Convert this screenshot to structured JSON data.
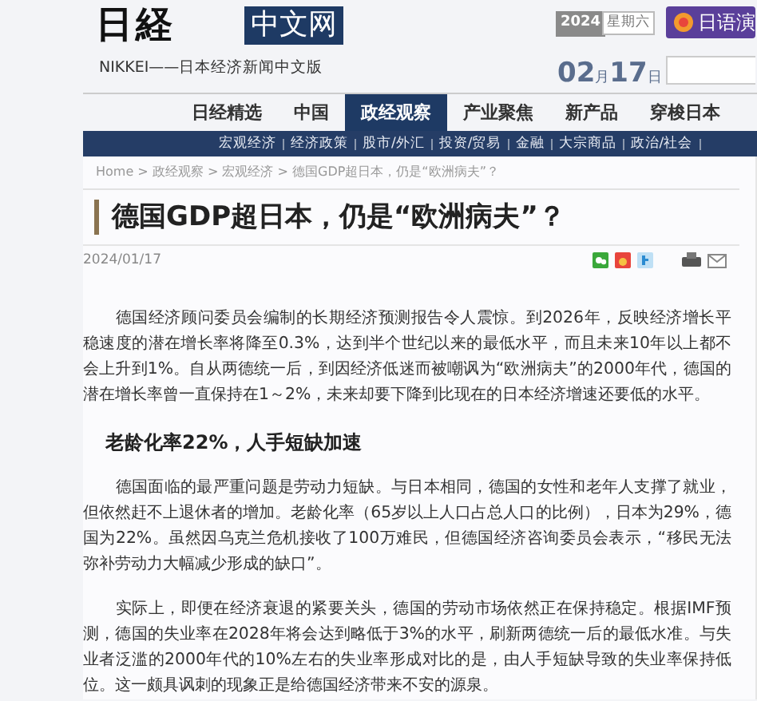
{
  "header": {
    "logo_mark": "日経",
    "logo_box": "中文网",
    "tagline": "NIKKEI——日本经济新闻中文版",
    "year": "2024",
    "weekday": "星期六",
    "month": "02",
    "month_unit": "月",
    "day": "17",
    "day_unit": "日",
    "promo_button": "日语演"
  },
  "nav": [
    {
      "label": "日经精选",
      "selected": false
    },
    {
      "label": "中国",
      "selected": false
    },
    {
      "label": "政经观察",
      "selected": true
    },
    {
      "label": "产业聚焦",
      "selected": false
    },
    {
      "label": "新产品",
      "selected": false
    },
    {
      "label": "穿梭日本",
      "selected": false
    }
  ],
  "subnav": [
    "宏观经济",
    "经济政策",
    "股市/外汇",
    "投资/贸易",
    "金融",
    "大宗商品",
    "政治/社会"
  ],
  "breadcrumb": "Home > 政经观察 > 宏观经济 > 德国GDP超日本，仍是“欧洲病夫”？",
  "article": {
    "title": "德国GDP超日本，仍是“欧洲病夫”？",
    "date": "2024/01/17",
    "blocks": [
      {
        "kind": "paragraph",
        "text": "德国经济顾问委员会编制的长期经济预测报告令人震惊。到2026年，反映经济增长平稳速度的潜在增长率将降至0.3%，达到半个世纪以来的最低水平，而且未来10年以上都不会上升到1%。自从两德统一后，到因经济低迷而被嘲讽为“欧洲病夫”的2000年代，德国的潜在增长率曾一直保持在1～2%，未来却要下降到比现在的日本经济增速还要低的水平。"
      },
      {
        "kind": "heading",
        "text": "老龄化率22%，人手短缺加速"
      },
      {
        "kind": "paragraph",
        "text": "德国面临的最严重问题是劳动力短缺。与日本相同，德国的女性和老年人支撑了就业，但依然赶不上退休者的增加。老龄化率（65岁以上人口占总人口的比例），日本为29%，德国为22%。虽然因乌克兰危机接收了100万难民，但德国经济咨询委员会表示，“移民无法弥补劳动力大幅减少形成的缺口”。"
      },
      {
        "kind": "paragraph",
        "text": "实际上，即便在经济衰退的紧要关头，德国的劳动市场依然正在保持稳定。根据IMF预测，德国的失业率在2028年将会达到略低于3%的水平，刷新两德统一后的最低水准。与失业者泛滥的2000年代的10%左右的失业率形成对比的是，由人手短缺导致的失业率保持低位。这一颇具讽刺的现象正是给德国经济带来不安的源泉。"
      }
    ]
  }
}
